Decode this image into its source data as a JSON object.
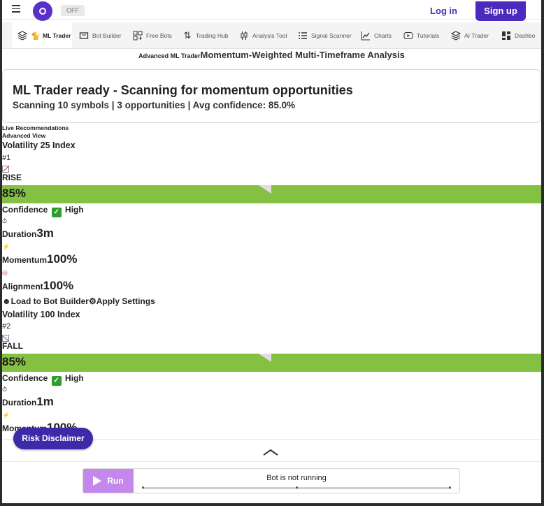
{
  "header": {
    "toggle_label": "OFF",
    "login_label": "Log in",
    "signup_label": "Sign up"
  },
  "tabs": [
    {
      "label": "ML Trader",
      "icon": "layers-icon"
    },
    {
      "label": "Bot Builder",
      "icon": "bot-icon"
    },
    {
      "label": "Free Bots",
      "icon": "grid-plus-icon"
    },
    {
      "label": "Trading Hub",
      "icon": "swap-icon"
    },
    {
      "label": "Analysis Tool",
      "icon": "candles-icon"
    },
    {
      "label": "Signal Scanner",
      "icon": "list-icon"
    },
    {
      "label": "Charts",
      "icon": "chart-line-icon"
    },
    {
      "label": "Tutorials",
      "icon": "play-icon"
    },
    {
      "label": "AI Trader",
      "icon": "layers-icon"
    },
    {
      "label": "Dashbo",
      "icon": "dashboard-icon"
    }
  ],
  "page": {
    "subtitle_small": "Advanced ML Trader",
    "subtitle_large": "Momentum-Weighted Multi-Timeframe Analysis"
  },
  "status": {
    "title": "ML Trader ready - Scanning for momentum opportunities",
    "summary": "Scanning 10 symbols | 3 opportunities | Avg confidence: 85.0%"
  },
  "recommendations": {
    "header": "Live Recommendations",
    "view": "Advanced View",
    "actions": {
      "load_label": "Load to Bot Builder",
      "apply_label": "Apply Settings"
    },
    "items": [
      {
        "symbol": "Volatility 25 Index",
        "rank": "#1",
        "direction": "RISE",
        "direction_icon": "chart-up-icon",
        "confidence_pct": "85%",
        "confidence_label": "Confidence",
        "confidence_level": "High",
        "duration_label": "Duration",
        "duration": "3m",
        "momentum_label": "Momentum",
        "momentum": "100%",
        "alignment_label": "Alignment",
        "alignment": "100%"
      },
      {
        "symbol": "Volatility 100 Index",
        "rank": "#2",
        "direction": "FALL",
        "direction_icon": "chart-down-icon",
        "confidence_pct": "85%",
        "confidence_label": "Confidence",
        "confidence_level": "High",
        "duration_label": "Duration",
        "duration": "1m",
        "momentum_label": "Momentum",
        "momentum": "100%"
      }
    ]
  },
  "footer": {
    "risk_label": "Risk Disclaimer",
    "run_label": "Run",
    "bot_status": "Bot is not running"
  },
  "colors": {
    "brand": "#4b2bbd",
    "confidence_bar": "#84c041",
    "run_button": "#c488ec"
  }
}
